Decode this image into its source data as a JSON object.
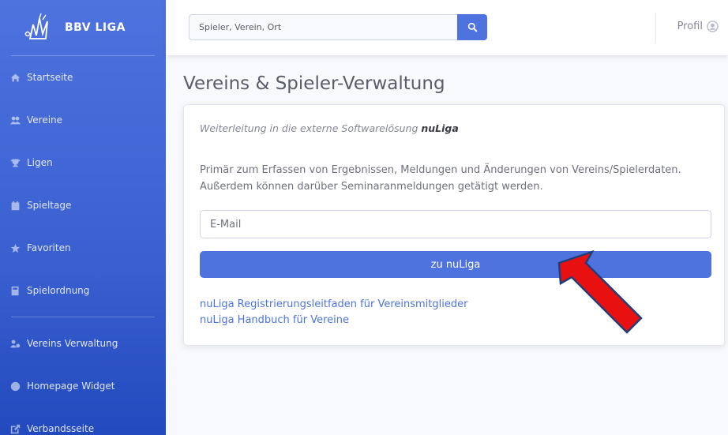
{
  "brand": {
    "name": "BBV LIGA"
  },
  "search": {
    "placeholder": "Spieler, Verein, Ort"
  },
  "profile": {
    "label": "Profil"
  },
  "sidebar": {
    "items": [
      {
        "label": "Startseite",
        "icon": "home-icon"
      },
      {
        "label": "Vereine",
        "icon": "users-icon"
      },
      {
        "label": "Ligen",
        "icon": "trophy-icon"
      },
      {
        "label": "Spieltage",
        "icon": "calendar-icon"
      },
      {
        "label": "Favoriten",
        "icon": "star-icon"
      },
      {
        "label": "Spielordnung",
        "icon": "book-icon"
      },
      {
        "label": "Vereins Verwaltung",
        "icon": "users-cog-icon"
      },
      {
        "label": "Homepage Widget",
        "icon": "globe-icon"
      },
      {
        "label": "Verbandsseite",
        "icon": "external-link-icon"
      }
    ]
  },
  "main": {
    "title": "Vereins & Spieler-Verwaltung",
    "intro_text": "Weiterleitung in die externe Softwarelösung ",
    "intro_bold": "nuLiga",
    "description": "Primär zum Erfassen von Ergebnissen, Meldungen und Änderungen von Vereins/Spielerdaten. Außerdem können darüber Seminaranmeldungen getätigt werden.",
    "email_placeholder": "E-Mail",
    "submit_label": "zu nuLiga",
    "links": [
      "nuLiga Registrierungsleitfaden für Vereinsmitglieder",
      "nuLiga Handbuch für Vereine"
    ]
  },
  "colors": {
    "primary": "#4e73df",
    "arrow": "#e81010"
  }
}
